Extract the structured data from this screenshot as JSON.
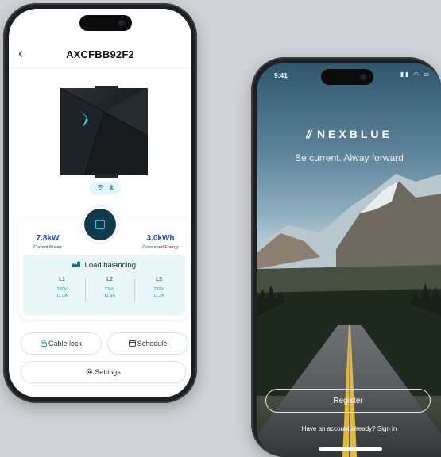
{
  "device_screen": {
    "title": "AXCFBB92F2",
    "back_icon": "chevron-left-icon",
    "connectivity_icons": [
      "wifi-icon",
      "bluetooth-icon"
    ],
    "current_power": {
      "value": "7.8kW",
      "label": "Current Power"
    },
    "consumed_energy": {
      "value": "3.0kWh",
      "label": "Consumed Energy"
    },
    "power_button_icon": "stop-square-icon",
    "load_balancing": {
      "title": "Load balancing",
      "phases": [
        {
          "name": "L1",
          "voltage": "230V",
          "current": "11.3A"
        },
        {
          "name": "L2",
          "voltage": "230V",
          "current": "11.3A"
        },
        {
          "name": "L3",
          "voltage": "230V",
          "current": "11.3A"
        }
      ]
    },
    "buttons": {
      "cable_lock": "Cable lock",
      "schedule": "Schedule",
      "settings": "Settings"
    }
  },
  "login_screen": {
    "status_time": "9:41",
    "brand": "NEXBLUE",
    "tagline": "Be current. Alway forward",
    "register_label": "Register",
    "signin_prompt": "Have an account already?",
    "signin_link": "Sign in"
  },
  "colors": {
    "accent_blue": "#1d4bb7",
    "accent_teal": "#1a9cb3",
    "dark_navy": "#123a4d"
  }
}
